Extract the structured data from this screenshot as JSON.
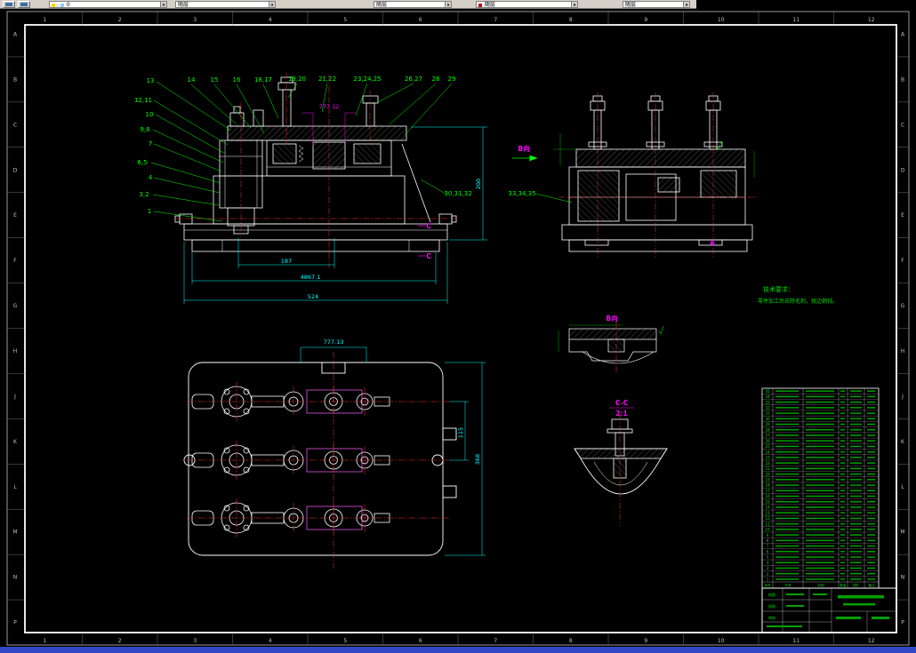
{
  "window": {
    "toolbar": {
      "combos": [
        "0",
        "随层",
        "随层",
        "随层",
        "随层"
      ]
    }
  },
  "frame": {
    "top_numbers": [
      "1",
      "2",
      "3",
      "4",
      "5",
      "6",
      "7",
      "8",
      "9",
      "10",
      "11",
      "12"
    ],
    "bottom_numbers": [
      "1",
      "2",
      "3",
      "4",
      "5",
      "6",
      "7",
      "8",
      "9",
      "10",
      "11",
      "12"
    ],
    "left_letters": [
      "A",
      "B",
      "C",
      "D",
      "E",
      "F",
      "G",
      "H",
      "J",
      "K",
      "L",
      "M",
      "N",
      "P"
    ],
    "right_letters": [
      "A",
      "B",
      "C",
      "D",
      "E",
      "F",
      "G",
      "H",
      "J",
      "K",
      "L",
      "M",
      "N",
      "P"
    ]
  },
  "drawing": {
    "colors": {
      "outline": "#ffffff",
      "dimension": "#00ffff",
      "annotation": "#00ff00",
      "centerline": "#ff0000",
      "section_label": "#ff00ff"
    },
    "callouts": [
      "13",
      "12,11",
      "10",
      "9,8",
      "7",
      "6,5",
      "4",
      "3,2",
      "1",
      "14",
      "15",
      "16",
      "18,17",
      "19,20",
      "21,22",
      "23,24,25",
      "26,27",
      "28",
      "29",
      "30,31,32",
      "33,34,35"
    ],
    "dims": {
      "d777a": "777.12",
      "d200": "200",
      "d187": "187",
      "d486": "4867.1",
      "d524": "524",
      "d777b": "777.13",
      "d368": "368",
      "d115": "115"
    },
    "labels": {
      "view_b": "B向",
      "detail_b": "B向",
      "section_cc": "C-C",
      "section_scale": "2:1",
      "cut_c": "C",
      "mark_a": "A"
    },
    "notes": {
      "title": "技术要求：",
      "line1": "零件加工后去除毛刺，锐边倒钝。"
    },
    "bom": {
      "headers": [
        "序号",
        "代号",
        "名称",
        "数量",
        "材料",
        "备注"
      ],
      "rows": [
        "35",
        "34",
        "33",
        "32",
        "31",
        "30",
        "29",
        "28",
        "27",
        "26",
        "25",
        "24",
        "23",
        "22",
        "21",
        "20",
        "19",
        "18",
        "17",
        "16",
        "15",
        "14",
        "13",
        "12",
        "11",
        "10",
        "9",
        "8",
        "7",
        "6",
        "5",
        "4",
        "3",
        "2",
        "1"
      ]
    },
    "title_block": {
      "roles": [
        "制图",
        "校核",
        "审核"
      ]
    }
  }
}
